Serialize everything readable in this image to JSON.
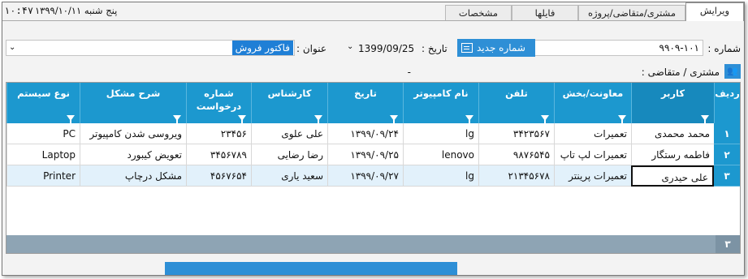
{
  "tabs": [
    {
      "label": "ویرایش",
      "active": true
    },
    {
      "label": "مشتری/متقاضی/پروژه",
      "active": false
    },
    {
      "label": "فایلها",
      "active": false
    },
    {
      "label": "مشخصات",
      "active": false
    }
  ],
  "header": {
    "date": "پنج شنبه ۱۳۹۹/۱۰/۱۱",
    "clock": "۱۰:۴۷"
  },
  "form": {
    "number_label": "شماره :",
    "number_value": "۹۹۰۹-۱۰۱",
    "new_number_button": "شماره جدید",
    "date_label": "تاریخ :",
    "date_value": "1399/09/25",
    "title_label": "عنوان :",
    "title_value": "فاکتور فروش",
    "customer_label": "مشتری / متقاضی :",
    "customer_value": "-"
  },
  "grid": {
    "columns": [
      "ردیف",
      "کاربر",
      "معاونت/بخش",
      "تلفن",
      "نام کامپیوتر",
      "تاریخ",
      "کارشناس",
      "شماره درخواست",
      "شرح مشکل",
      "نوع سیستم"
    ],
    "rows": [
      [
        "۱",
        "محمد محمدی",
        "تعمیرات",
        "۳۴۲۳۵۶۷",
        "lg",
        "۱۳۹۹/۰۹/۲۴",
        "علی علوی",
        "۲۳۴۵۶",
        "ویروسی شدن کامپیوتر",
        "PC"
      ],
      [
        "۲",
        "فاطمه رستگار",
        "تعمیرات لپ تاپ",
        "۹۸۷۶۵۴۵",
        "lenovo",
        "۱۳۹۹/۰۹/۲۵",
        "رضا رضایی",
        "۳۴۵۶۷۸۹",
        "تعویض کیبورد",
        "Laptop"
      ],
      [
        "۳",
        "علی حیدری",
        "تعمیرات پرینتر",
        "۲۱۳۴۵۶۷۸",
        "lg",
        "۱۳۹۹/۰۹/۲۷",
        "سعید یاری",
        "۴۵۶۷۶۵۴",
        "مشکل درچاپ",
        "Printer"
      ]
    ],
    "footer_count": "۳"
  },
  "colors": {
    "accent": "#1c98cf",
    "button": "#2e8fd6",
    "footer": "#8ea4b4"
  }
}
